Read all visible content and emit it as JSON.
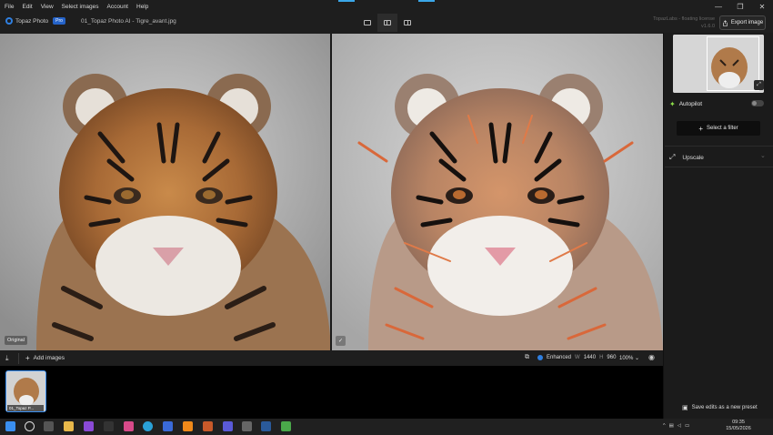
{
  "menu": [
    "File",
    "Edit",
    "View",
    "Select images",
    "Account",
    "Help"
  ],
  "window_controls": [
    "—",
    "❐",
    "✕"
  ],
  "brand": {
    "name": "Topaz Photo",
    "badge": "Pro"
  },
  "document": {
    "filename": "01_Topaz Photo AI - Tigre_avant.jpg"
  },
  "license": {
    "line1": "TopazLabs - floating license",
    "line2": "v1.6.0"
  },
  "export": {
    "label": "Export image"
  },
  "view_modes": [
    "single-view",
    "split-view",
    "side-by-side-view"
  ],
  "original_tag": "Original",
  "side": {
    "autopilot_label": "Autopilot",
    "select_filter_label": "Select a filter",
    "upscale_label": "Upscale",
    "save_preset_label": "Save edits as a new preset"
  },
  "bottom": {
    "add_images": "Add images",
    "enhanced_label": "Enhanced",
    "w_label": "W",
    "width": "1440",
    "h_label": "H",
    "height": "960",
    "zoom": "100%"
  },
  "filmstrip": {
    "item_label": "01_Topaz P..."
  },
  "taskbar": {
    "time": "09:35",
    "date": "15/05/2026",
    "tray_text": "^"
  },
  "colors": {
    "accent": "#2f7fe0",
    "autopilot": "#8ee04a",
    "selection": "#3a8ff0"
  }
}
